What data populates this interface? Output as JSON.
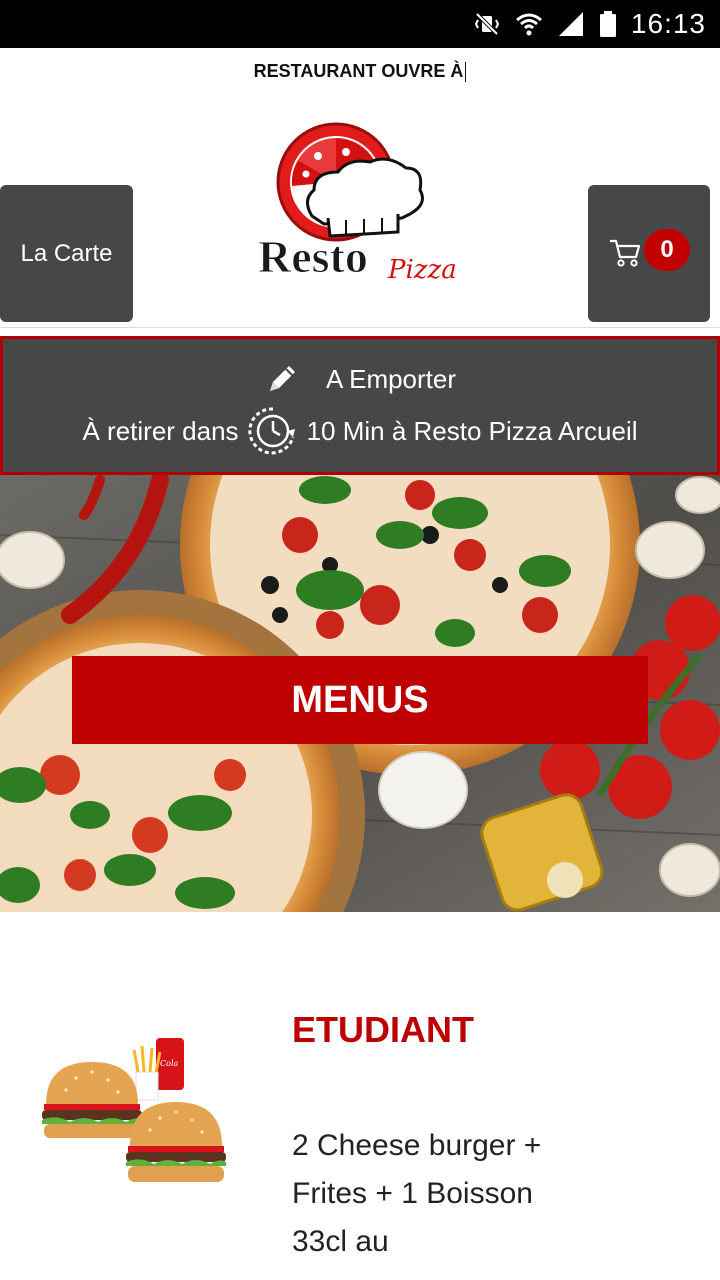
{
  "status_bar": {
    "time": "16:13",
    "icons": [
      "mute-vibrate-icon",
      "wifi-icon",
      "signal-icon",
      "battery-icon"
    ]
  },
  "ticker": {
    "text": "RESTAURANT OUVRE À"
  },
  "header": {
    "menu_button_label": "La Carte",
    "cart_count": "0",
    "logo_text": "Resto",
    "logo_script": "Pizza"
  },
  "mode_bar": {
    "mode_label": "A Emporter",
    "pickup_prefix": "À retirer dans",
    "pickup_detail": "10 Min à Resto Pizza Arcueil"
  },
  "hero": {
    "banner_label": "MENUS"
  },
  "menu_item": {
    "title": "ETUDIANT",
    "description": "2 Cheese burger + Frites + 1 Boisson 33cl au"
  },
  "colors": {
    "accent_red": "#bf0000",
    "dark_button": "#474747",
    "text_dark": "#222222"
  }
}
